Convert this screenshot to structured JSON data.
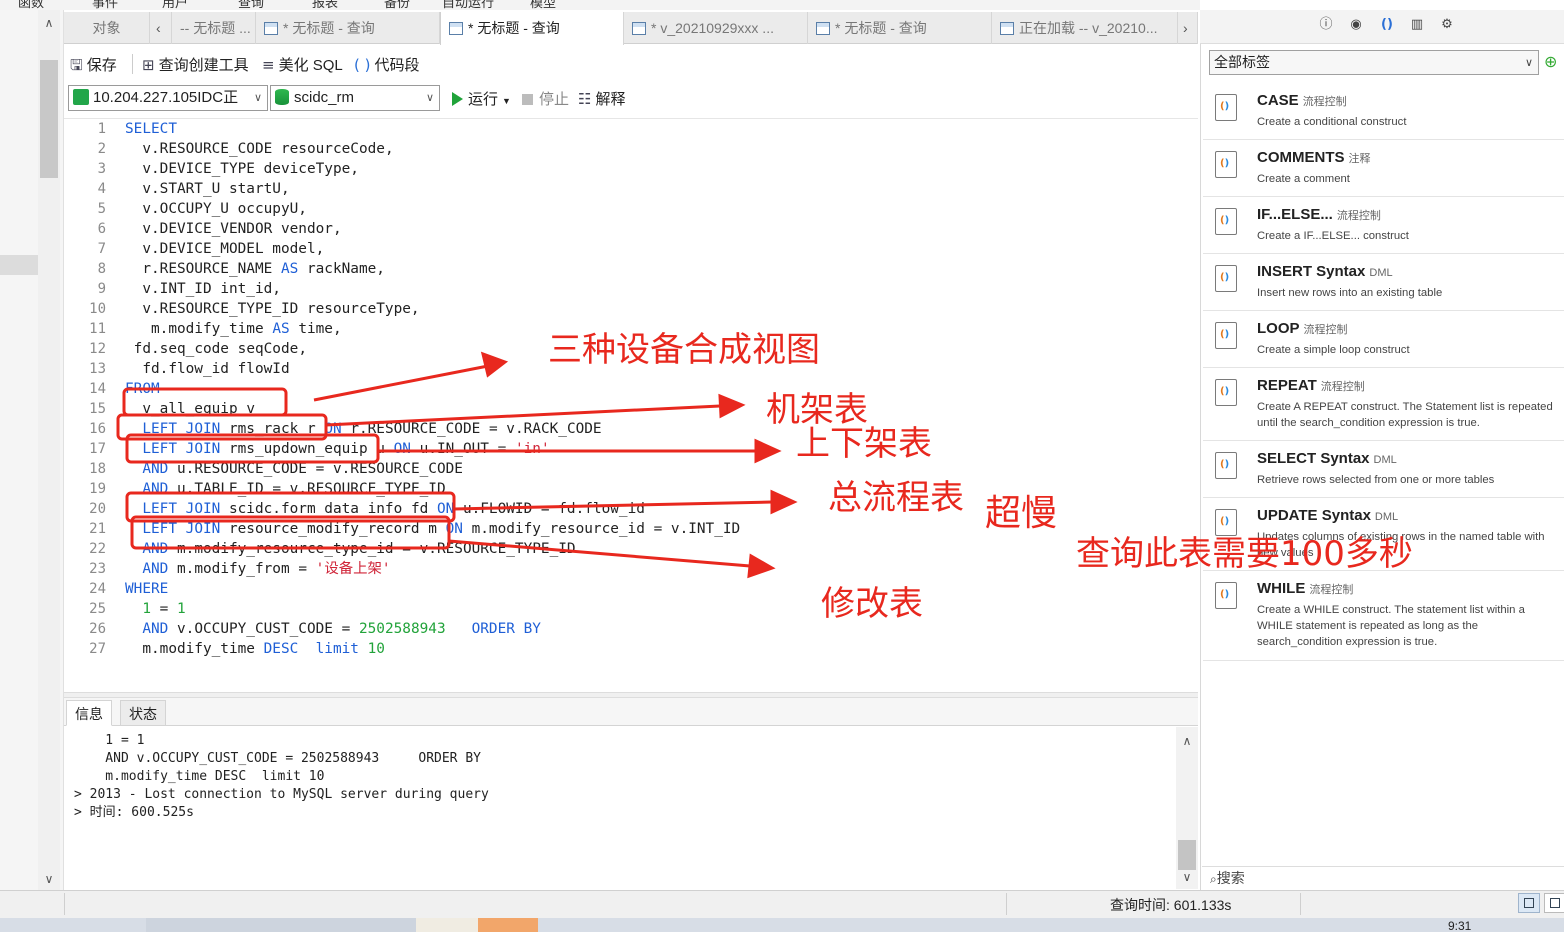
{
  "menu": [
    "函数",
    "事件",
    "用户",
    "查询",
    "报表",
    "备份",
    "自动运行",
    "模型"
  ],
  "tabs": [
    {
      "label": "对象",
      "active": false
    },
    {
      "label": "-- 无标题 ...",
      "active": false
    },
    {
      "label": "* 无标题 - 查询",
      "active": false
    },
    {
      "label": "* 无标题 - 查询",
      "active": true
    },
    {
      "label": "* v_20210929xxx ...",
      "active": false
    },
    {
      "label": "* 无标题 - 查询",
      "active": false
    },
    {
      "label": "正在加载 -- v_20210...",
      "active": false
    }
  ],
  "toolbar1": {
    "save": "保存",
    "query_builder": "查询创建工具",
    "beautify": "美化 SQL",
    "snippet": "代码段"
  },
  "toolbar2": {
    "connection": "10.204.227.105IDC正",
    "database": "scidc_rm",
    "run": "运行",
    "stop": "停止",
    "explain": "解释"
  },
  "editor": {
    "lines": [
      "SELECT",
      "  v.RESOURCE_CODE resourceCode,",
      "  v.DEVICE_TYPE deviceType,",
      "  v.START_U startU,",
      "  v.OCCUPY_U occupyU,",
      "  v.DEVICE_VENDOR vendor,",
      "  v.DEVICE_MODEL model,",
      "  r.RESOURCE_NAME AS rackName,",
      "  v.INT_ID int_id,",
      "  v.RESOURCE_TYPE_ID resourceType,",
      "   m.modify_time AS time,",
      " fd.seq_code seqCode,",
      "  fd.flow_id flowId",
      "FROM",
      "  v_all_equip v",
      "  LEFT JOIN rms_rack r ON r.RESOURCE_CODE = v.RACK_CODE",
      "  LEFT JOIN rms_updown_equip u ON u.IN_OUT = 'in'",
      "  AND u.RESOURCE_CODE = v.RESOURCE_CODE",
      "  AND u.TABLE_ID = v.RESOURCE_TYPE_ID",
      "  LEFT JOIN scidc.form_data_info fd ON u.FLOWID = fd.flow_id",
      "  LEFT JOIN resource_modify_record m ON m.modify_resource_id = v.INT_ID",
      "  AND m.modify_resource_type_id = v.RESOURCE_TYPE_ID",
      "  AND m.modify_from = '设备上架'",
      "WHERE",
      "  1 = 1",
      "  AND v.OCCUPY_CUST_CODE = 2502588943   ORDER BY",
      "  m.modify_time DESC  limit 10"
    ]
  },
  "bottom_tabs": [
    "信息",
    "状态"
  ],
  "output_lines": [
    "    1 = 1",
    "    AND v.OCCUPY_CUST_CODE = 2502588943     ORDER BY",
    "    m.modify_time DESC  limit 10",
    "> 2013 - Lost connection to MySQL server during query",
    "> 时间: 600.525s"
  ],
  "status": {
    "query_time": "查询时间: 601.133s"
  },
  "clock": "9:31",
  "right_panel": {
    "tag_filter": "全部标签",
    "search_placeholder": "搜索",
    "snippets": [
      {
        "title": "CASE",
        "tag": "流程控制",
        "desc": "Create a conditional construct"
      },
      {
        "title": "COMMENTS",
        "tag": "注释",
        "desc": "Create a comment"
      },
      {
        "title": "IF...ELSE...",
        "tag": "流程控制",
        "desc": "Create a IF...ELSE... construct"
      },
      {
        "title": "INSERT Syntax",
        "tag": "DML",
        "desc": "Insert new rows into an existing table"
      },
      {
        "title": "LOOP",
        "tag": "流程控制",
        "desc": "Create a simple loop construct"
      },
      {
        "title": "REPEAT",
        "tag": "流程控制",
        "desc": "Create A REPEAT construct. The Statement list is repeated until the search_condition expression is true."
      },
      {
        "title": "SELECT Syntax",
        "tag": "DML",
        "desc": "Retrieve rows selected from one or more tables"
      },
      {
        "title": "UPDATE Syntax",
        "tag": "DML",
        "desc": "Updates columns of existing rows in the named table with new values"
      },
      {
        "title": "WHILE",
        "tag": "流程控制",
        "desc": "Create a WHILE construct. The statement list within a WHILE statement is repeated as long as the search_condition expression is true."
      }
    ]
  },
  "annotations": {
    "view": "三种设备合成视图",
    "rack": "机架表",
    "updown": "上下架表",
    "flow": "总流程表",
    "slow": "超慢",
    "modify": "修改表",
    "note": "查询此表需要100多秒"
  },
  "colors": {
    "annotation_red": "#e8281e",
    "keyword_blue": "#1f5fd6",
    "number_green": "#22a33a",
    "string_red": "#d0263a"
  }
}
